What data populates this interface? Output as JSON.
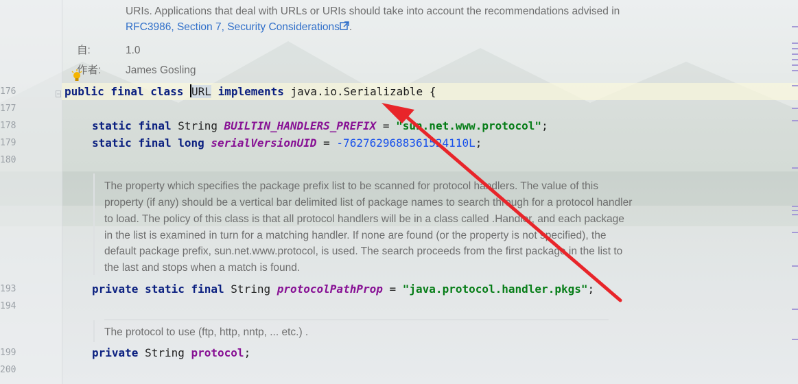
{
  "javadoc_top": {
    "text_line1": "URIs. Applications that deal with URLs or URIs should take into account the recommendations advised in",
    "link": "RFC3986, Section 7, Security Considerations",
    "period": ".",
    "since_label": "自:",
    "since_value": "1.0",
    "author_label": "作者:",
    "author_value": "James Gosling"
  },
  "lines": {
    "ln176": "176",
    "ln177": "177",
    "ln178": "178",
    "ln179": "179",
    "ln180": "180",
    "ln193": "193",
    "ln194": "194",
    "ln199": "199",
    "ln200": "200"
  },
  "code": {
    "l176_kw": "public final class ",
    "l176_name": "URL",
    "l176_impl": " implements ",
    "l176_rest": "java.io.Serializable {",
    "l178_kw": "static final ",
    "l178_type": "String ",
    "l178_field": "BUILTIN_HANDLERS_PREFIX",
    "l178_eq": " = ",
    "l178_str": "\"sun.net.www.protocol\"",
    "l178_end": ";",
    "l179_kw": "static final long ",
    "l179_field": "serialVersionUID",
    "l179_eq": " = ",
    "l179_num": "-7627629688361524110L",
    "l179_end": ";",
    "l193_kw": "private static final ",
    "l193_type": "String ",
    "l193_field": "protocolPathProp",
    "l193_eq": " = ",
    "l193_str": "\"java.protocol.handler.pkgs\"",
    "l193_end": ";",
    "l199_kw": "private ",
    "l199_type": "String ",
    "l199_field": "protocol",
    "l199_end": ";"
  },
  "doc_prefix": [
    "The property which specifies the package prefix list to be scanned for protocol handlers. The value of this",
    "property (if any) should be a vertical bar delimited list of package names to search through for a protocol handler",
    "to load. The policy of this class is that all protocol handlers will be in a class called .Handler, and each package",
    "in the list is examined in turn for a matching handler. If none are found (or the property is not specified), the",
    "default package prefix, sun.net.www.protocol, is used. The search proceeds from the first package in the list to",
    "the last and stops when a match is found."
  ],
  "doc_protocol": "The protocol to use (ftp, http, nntp, ... etc.) .",
  "icons": {
    "external_link": "external-link-icon",
    "bulb": "lightbulb-icon",
    "fold": "fold-icon"
  },
  "colors": {
    "keyword": "#0b2080",
    "field": "#871094",
    "string": "#067d17",
    "number": "#1750eb",
    "annotation_arrow": "#e8252a"
  }
}
